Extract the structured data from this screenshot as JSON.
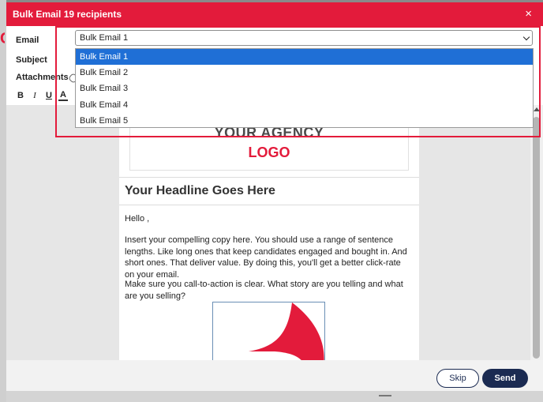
{
  "modal": {
    "title": "Bulk Email 19 recipients",
    "close_glyph": "×"
  },
  "form": {
    "email_label": "Email",
    "subject_label": "Subject",
    "attachments_label": "Attachments",
    "email_selected": "Bulk Email 1",
    "email_options": [
      "Bulk Email 1",
      "Bulk Email 2",
      "Bulk Email 3",
      "Bulk Email 4",
      "Bulk Email 5"
    ],
    "highlighted_option_index": 0
  },
  "toolbar": {
    "bold": "B",
    "italic": "I",
    "underline": "U",
    "font_color": "A"
  },
  "email_body": {
    "logo_line1": "YOUR AGENCY",
    "logo_line2": "LOGO",
    "headline": "Your Headline Goes Here",
    "greeting": "Hello ,",
    "paragraph1": "Insert your compelling copy here. You should use a range of sentence lengths. Like long ones that keep candidates engaged and bought in. And short ones. That deliver value. By doing this, you'll get a better click-rate on your email.",
    "paragraph2": "Make sure you call-to-action is clear. What story are you telling and what are you selling?"
  },
  "buttons": {
    "skip": "Skip",
    "send": "Send"
  },
  "colors": {
    "brand_red": "#e31b3b",
    "navy": "#1b2b52",
    "option_highlight": "#1f6fd6"
  },
  "icons": {
    "close": "close-icon",
    "attachment": "paperclip-icon",
    "dropdown": "chevron-down-icon"
  }
}
